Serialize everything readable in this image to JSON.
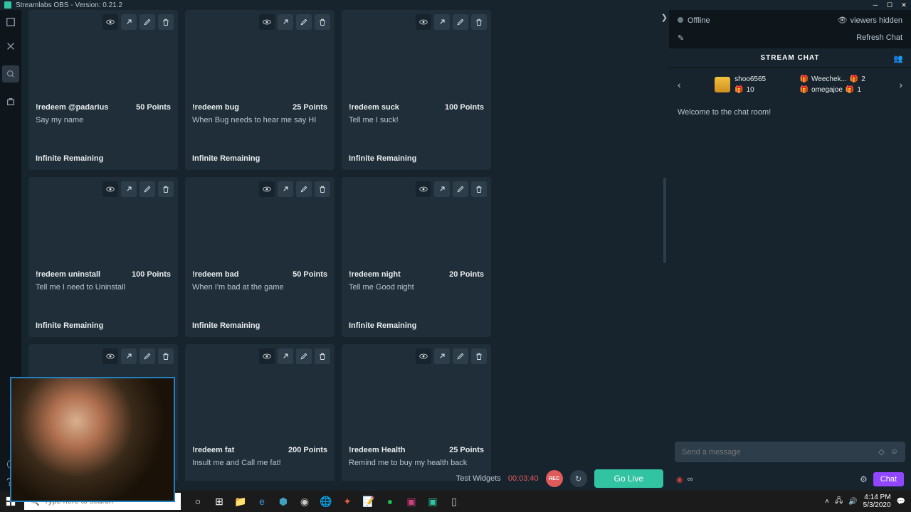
{
  "window": {
    "title": "Streamlabs OBS - Version: 0.21.2"
  },
  "cards": [
    {
      "cmd": "!redeem @padarius",
      "pts": "50 Points",
      "desc": "Say my name",
      "remain": "Infinite Remaining"
    },
    {
      "cmd": "!redeem bug",
      "pts": "25 Points",
      "desc": "When Bug needs to hear me say HI",
      "remain": "Infinite Remaining"
    },
    {
      "cmd": "!redeem suck",
      "pts": "100 Points",
      "desc": "Tell me I suck!",
      "remain": "Infinite Remaining"
    },
    {
      "cmd": "!redeem uninstall",
      "pts": "100 Points",
      "desc": "Tell me I need to Uninstall",
      "remain": "Infinite Remaining"
    },
    {
      "cmd": "!redeem bad",
      "pts": "50 Points",
      "desc": "When I'm bad at the game",
      "remain": "Infinite Remaining"
    },
    {
      "cmd": "!redeem night",
      "pts": "20 Points",
      "desc": "Tell me Good night",
      "remain": "Infinite Remaining"
    },
    {
      "cmd": "",
      "pts": "",
      "desc": "",
      "remain": ""
    },
    {
      "cmd": "!redeem fat",
      "pts": "200 Points",
      "desc": "Insult me and Call me fat!",
      "remain": ""
    },
    {
      "cmd": "!redeem Health",
      "pts": "25 Points",
      "desc": "Remind me to buy my health back",
      "remain": ""
    }
  ],
  "bottom": {
    "test": "Test Widgets",
    "timer": "00:03:40",
    "rec": "REC",
    "golive": "Go Live"
  },
  "chat": {
    "status": "Offline",
    "viewers": "viewers hidden",
    "refresh": "Refresh Chat",
    "title": "STREAM CHAT",
    "gift": {
      "main_name": "shoo6565",
      "main_count": "10",
      "side1_name": "Weechek...",
      "side1_count": "2",
      "side2_name": "omegajoe",
      "side2_count": "1"
    },
    "welcome": "Welcome to the chat room!",
    "placeholder": "Send a message",
    "points": "∞",
    "chat_btn": "Chat"
  },
  "taskbar": {
    "search_placeholder": "Type here to search",
    "time": "4:14 PM",
    "date": "5/3/2020"
  }
}
